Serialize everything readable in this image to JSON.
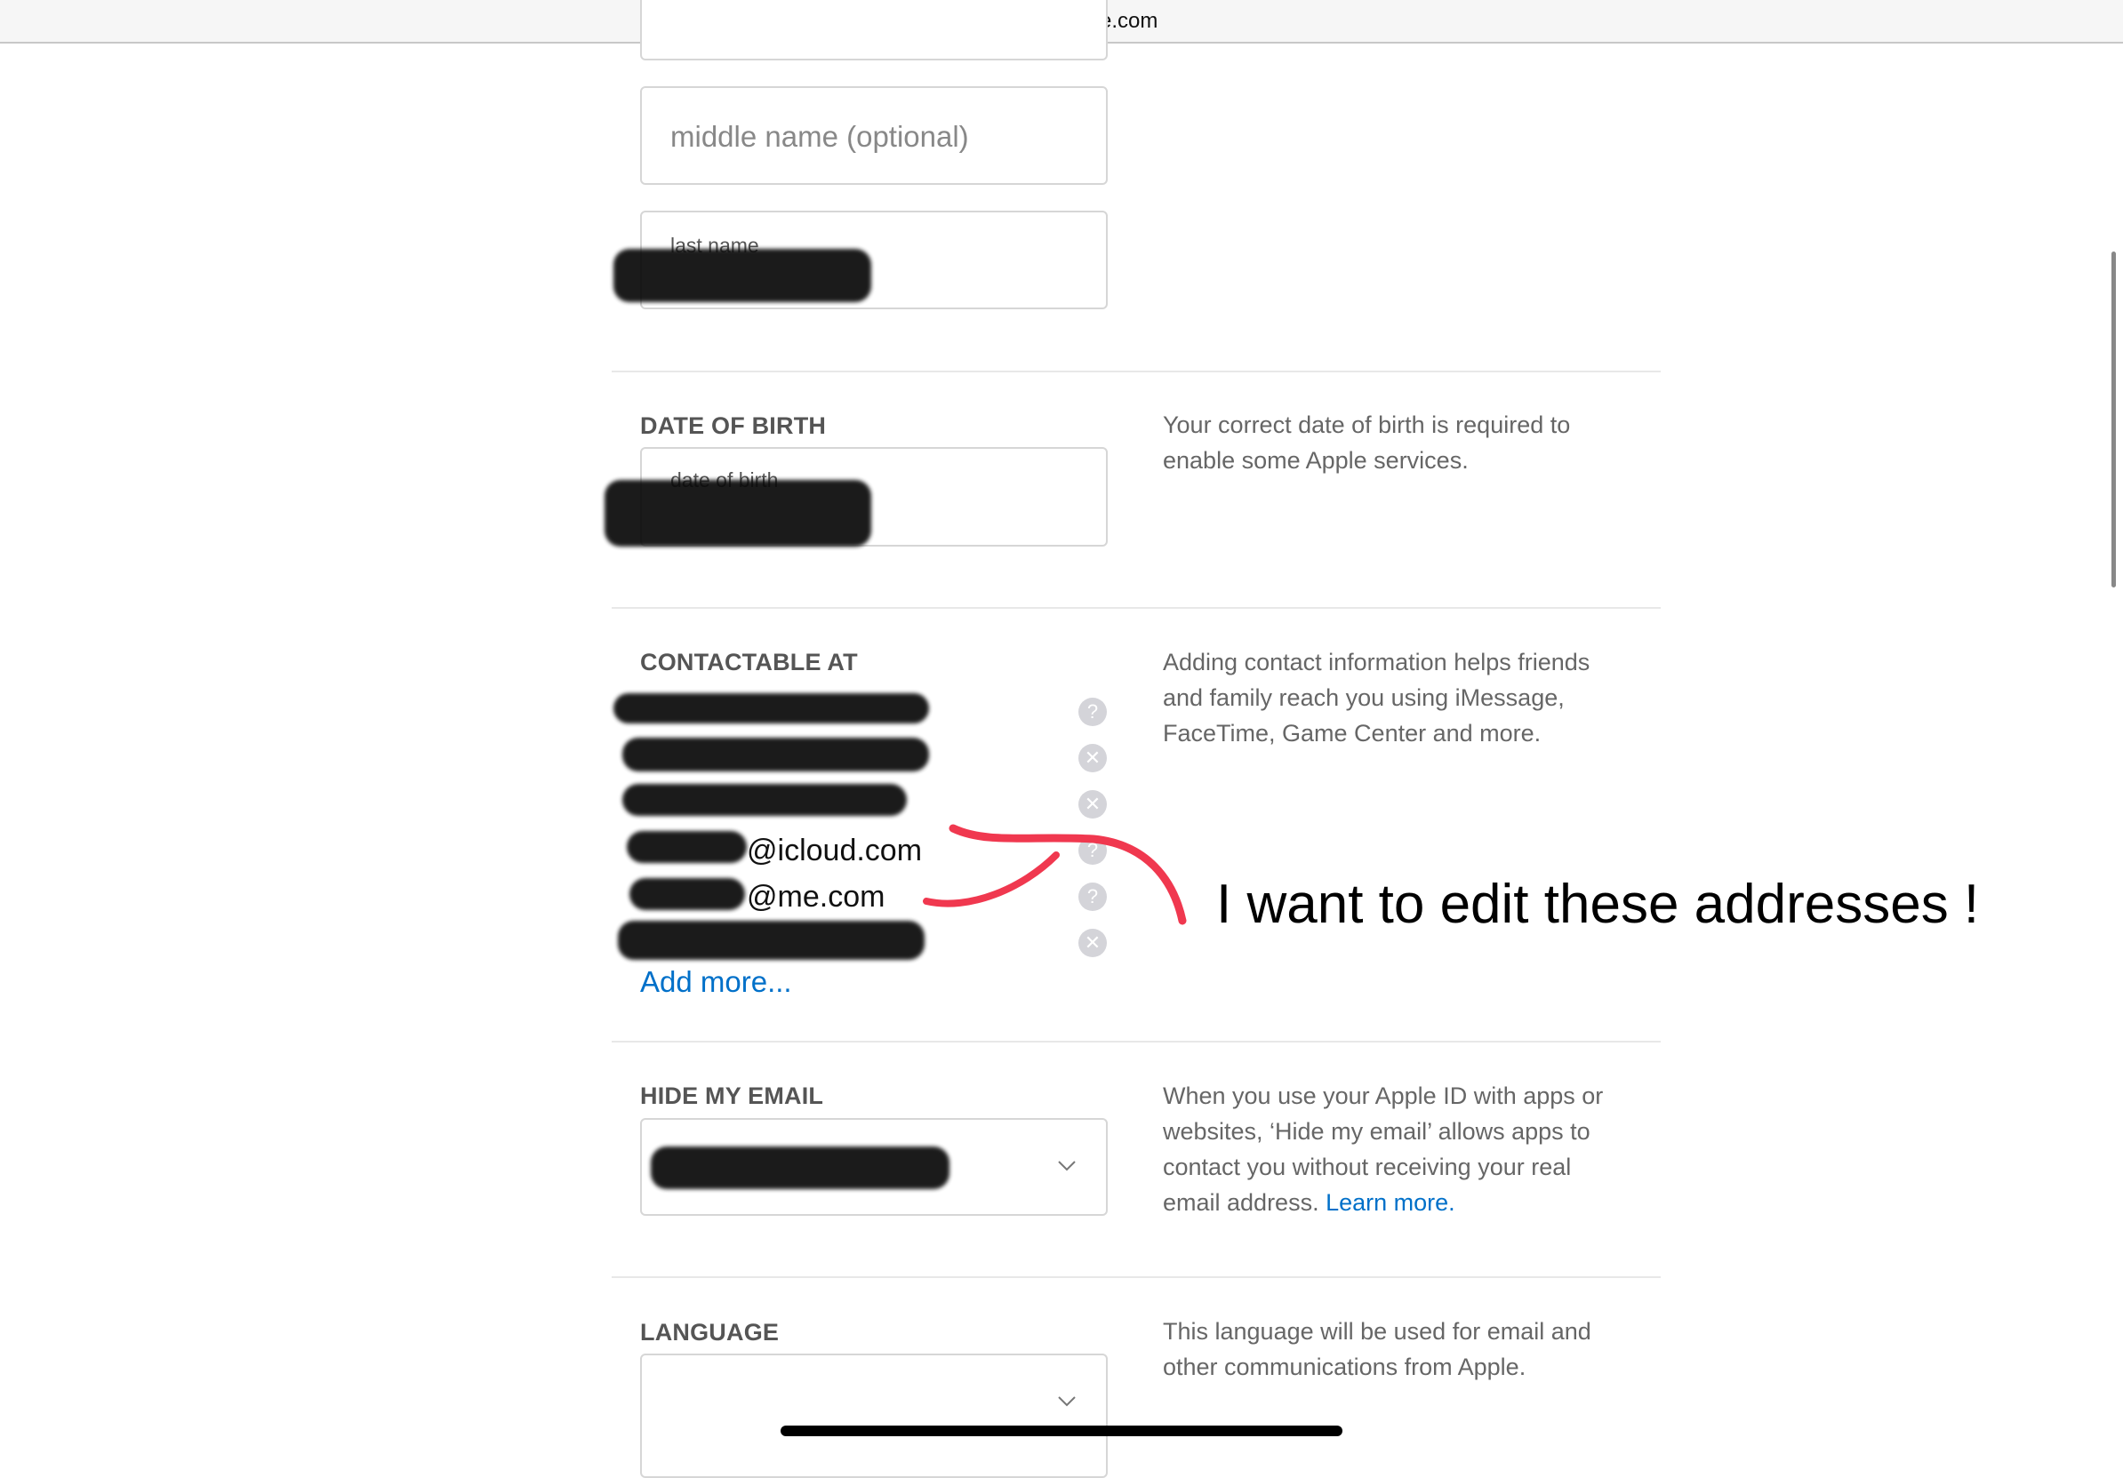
{
  "browser": {
    "url": "appleid.apple.com",
    "lock_icon": "lock-icon"
  },
  "name_fields": {
    "middle_name_placeholder": "middle name (optional)",
    "last_name_label": "last name",
    "last_name_value": "[redacted]"
  },
  "date_of_birth": {
    "title": "DATE OF BIRTH",
    "field_label": "date of birth",
    "field_value": "[redacted]",
    "description": "Your correct date of birth is required to enable some Apple services."
  },
  "contactable_at": {
    "title": "CONTACTABLE AT",
    "items": [
      {
        "text": "[redacted]",
        "icon": "question-icon",
        "redacted": true
      },
      {
        "text": "[redacted]",
        "icon": "remove-icon",
        "redacted": true
      },
      {
        "text": "[redacted]",
        "icon": "remove-icon",
        "redacted": true
      },
      {
        "text": "@icloud.com",
        "icon": "question-icon",
        "redacted": true
      },
      {
        "text": "@me.com",
        "icon": "question-icon",
        "redacted": true
      },
      {
        "text": "[redacted]",
        "icon": "remove-icon",
        "redacted": true
      }
    ],
    "add_more": "Add more...",
    "description": "Adding contact information helps friends and family reach you using iMessage, FaceTime, Game Center and more."
  },
  "hide_my_email": {
    "title": "HIDE MY EMAIL",
    "selected": "[redacted]",
    "description": "When you use your Apple ID with apps or websites, ‘Hide my email’ allows apps to contact you without receiving your real email address.",
    "learn_more": "Learn more."
  },
  "language": {
    "title": "LANGUAGE",
    "selected": "",
    "description": "This language will be used for email and other communications from Apple."
  },
  "annotation": {
    "text": "I want to edit these addresses !",
    "color": "#f0384f"
  },
  "colors": {
    "link": "#0070c9",
    "section_title": "#555555",
    "description": "#666666"
  }
}
